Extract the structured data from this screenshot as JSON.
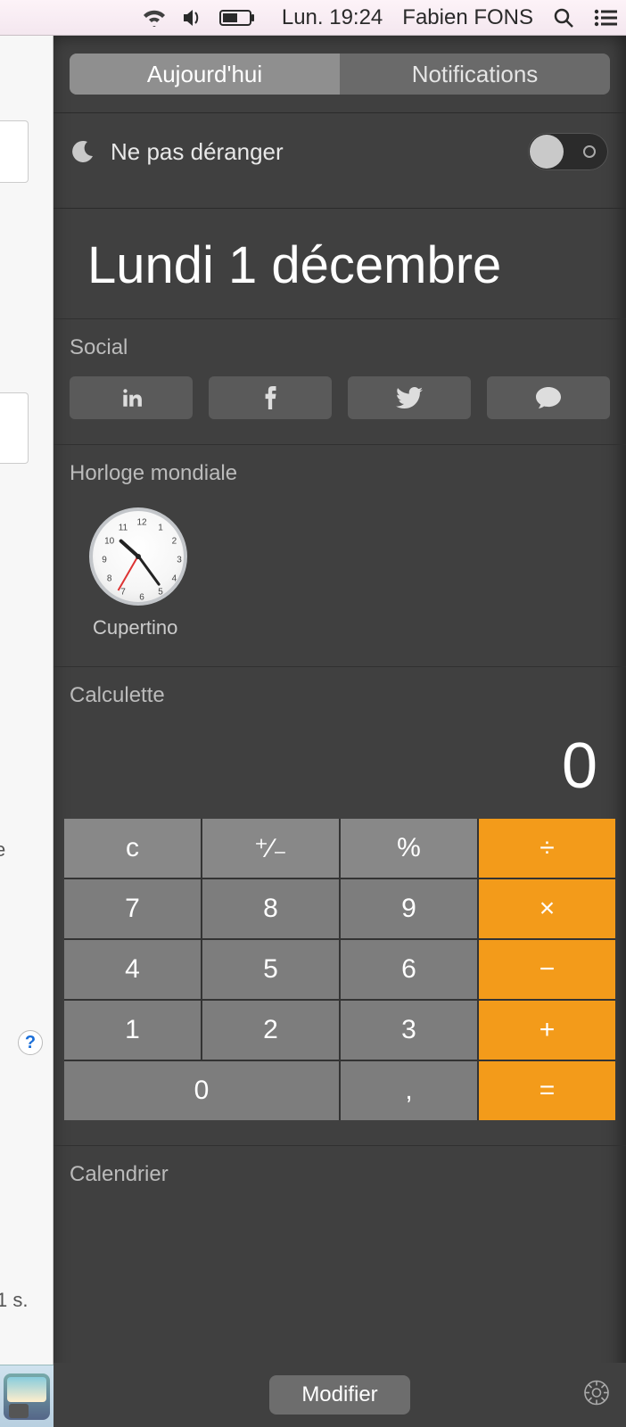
{
  "menubar": {
    "day_time": "Lun. 19:24",
    "user": "Fabien FONS"
  },
  "left": {
    "peek_text_1": "e",
    "peek_text_2": "1 s.",
    "help": "?"
  },
  "tabs": {
    "today": "Aujourd'hui",
    "notifications": "Notifications",
    "active": "today"
  },
  "dnd": {
    "label": "Ne pas déranger",
    "enabled": false
  },
  "date": "Lundi 1 décembre",
  "social": {
    "title": "Social",
    "items": [
      "linkedin",
      "facebook",
      "twitter",
      "messages"
    ]
  },
  "worldclock": {
    "title": "Horloge mondiale",
    "clocks": [
      {
        "city": "Cupertino",
        "hour": 10,
        "minute": 24,
        "second": 35
      }
    ]
  },
  "calculator": {
    "title": "Calculette",
    "display": "0",
    "keys": {
      "c": "c",
      "pm": "⁺∕₋",
      "pct": "%",
      "div": "÷",
      "7": "7",
      "8": "8",
      "9": "9",
      "mul": "×",
      "4": "4",
      "5": "5",
      "6": "6",
      "sub": "−",
      "1": "1",
      "2": "2",
      "3": "3",
      "add": "+",
      "0": "0",
      "dec": ",",
      "eq": "="
    }
  },
  "calendar": {
    "title": "Calendrier"
  },
  "footer": {
    "edit": "Modifier"
  }
}
